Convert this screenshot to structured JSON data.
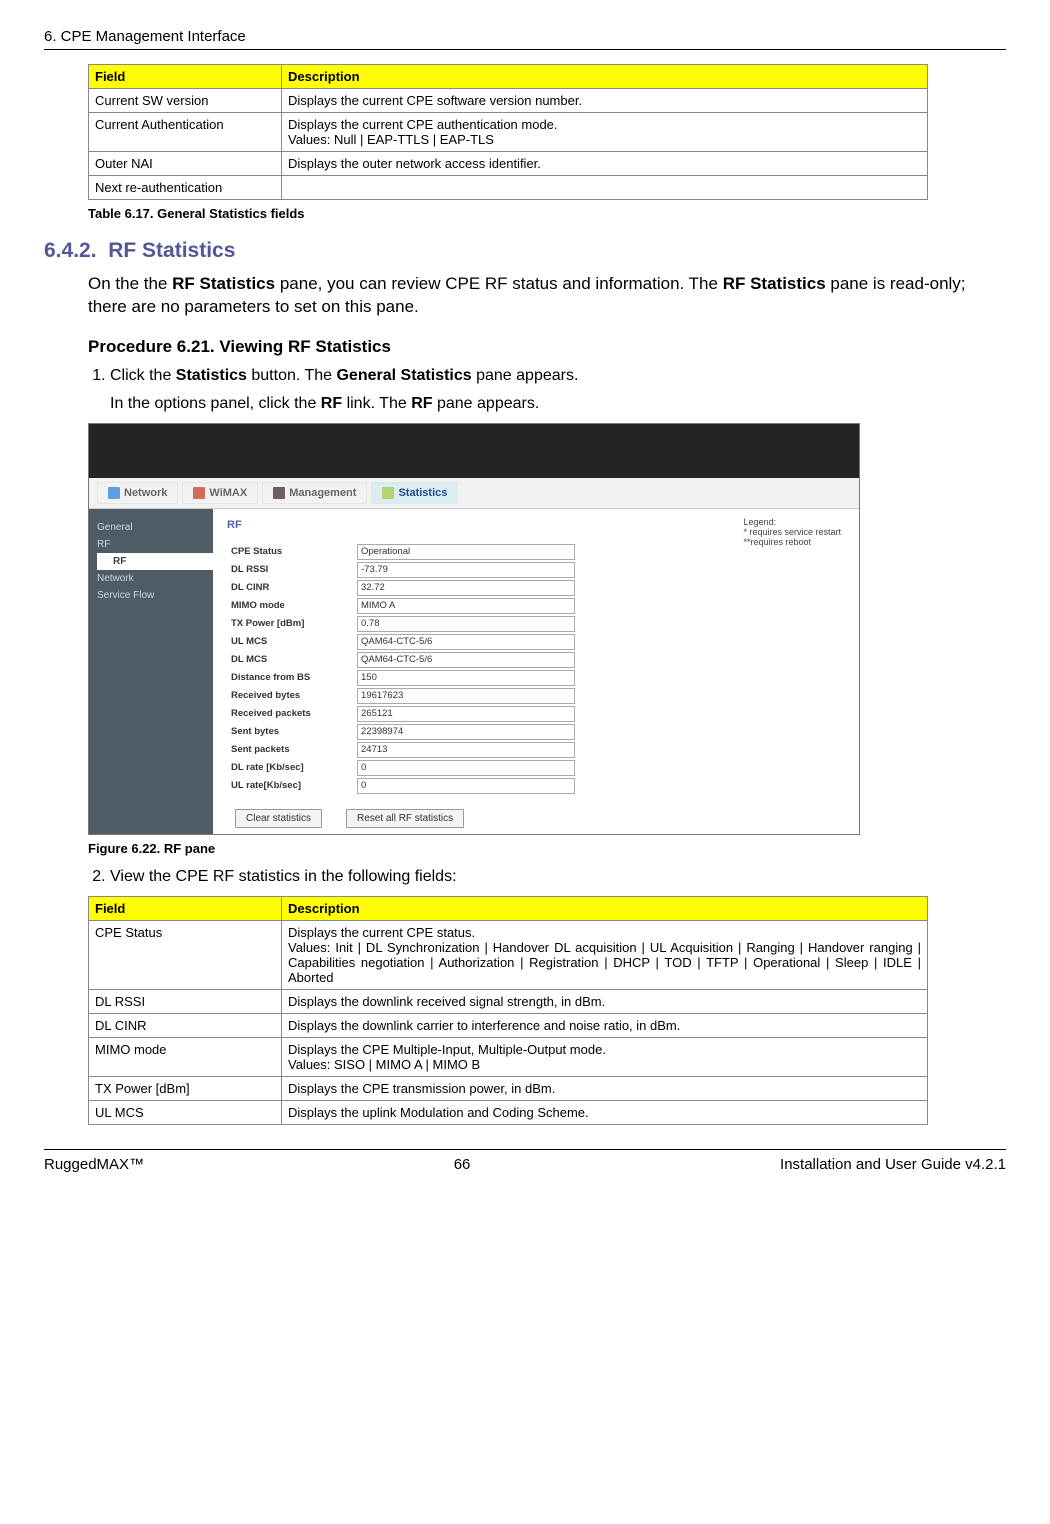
{
  "header": {
    "left": "6. CPE Management Interface"
  },
  "table1": {
    "headers": {
      "field": "Field",
      "desc": "Description"
    },
    "rows": [
      {
        "field": "Current SW version",
        "desc": "Displays the current CPE software version number."
      },
      {
        "field": "Current Authentication",
        "desc": "Displays the current CPE authentication mode.\nValues: Null | EAP-TTLS | EAP-TLS"
      },
      {
        "field": "Outer NAI",
        "desc": "Displays the outer network access identifier."
      },
      {
        "field": "Next re-authentication",
        "desc": ""
      }
    ],
    "caption": "Table 6.17. General Statistics fields"
  },
  "section": {
    "number": "6.4.2.",
    "title": "RF Statistics",
    "para_parts": [
      "On the the ",
      "RF Statistics",
      " pane, you can review CPE RF status and information. The ",
      "RF Statistics",
      " pane is read-only; there are no parameters to set on this pane."
    ],
    "proc_title": "Procedure 6.21. Viewing RF Statistics",
    "step1_parts": [
      "Click the ",
      "Statistics",
      " button. The ",
      "General Statistics",
      " pane appears."
    ],
    "step1_sub_parts": [
      "In the options panel, click the ",
      "RF",
      " link. The ",
      "RF",
      " pane appears."
    ],
    "figure_caption": "Figure 6.22. RF pane",
    "step2": "View the CPE RF statistics in the following fields:"
  },
  "screenshot": {
    "nav": [
      {
        "label": "Network",
        "icon": "blue"
      },
      {
        "label": "WiMAX",
        "icon": "red"
      },
      {
        "label": "Management",
        "icon": "dark"
      },
      {
        "label": "Statistics",
        "icon": "chart",
        "active": true
      }
    ],
    "sidebar": [
      {
        "label": "General"
      },
      {
        "label": "RF"
      },
      {
        "label": "RF",
        "selected": true
      },
      {
        "label": "Network"
      },
      {
        "label": "Service Flow"
      }
    ],
    "legend": {
      "title": "Legend:",
      "l1": "* requires service restart",
      "l2": "**requires reboot"
    },
    "panel_title": "RF",
    "fields": [
      {
        "label": "CPE Status",
        "value": "Operational"
      },
      {
        "label": "DL RSSI",
        "value": "-73.79"
      },
      {
        "label": "DL CINR",
        "value": "32.72"
      },
      {
        "label": "MIMO mode",
        "value": "MIMO A"
      },
      {
        "label": "TX Power [dBm]",
        "value": "0.78"
      },
      {
        "label": "UL MCS",
        "value": "QAM64-CTC-5/6"
      },
      {
        "label": "DL MCS",
        "value": "QAM64-CTC-5/6"
      },
      {
        "label": "Distance from BS",
        "value": "150"
      },
      {
        "label": "Received bytes",
        "value": "19617623"
      },
      {
        "label": "Received packets",
        "value": "265121"
      },
      {
        "label": "Sent bytes",
        "value": "22398974"
      },
      {
        "label": "Sent packets",
        "value": "24713"
      },
      {
        "label": "DL rate [Kb/sec]",
        "value": "0"
      },
      {
        "label": "UL rate[Kb/sec]",
        "value": "0"
      }
    ],
    "buttons": {
      "clear": "Clear statistics",
      "reset": "Reset all RF statistics"
    }
  },
  "table2": {
    "headers": {
      "field": "Field",
      "desc": "Description"
    },
    "rows": [
      {
        "field": "CPE Status",
        "desc": "Displays the current CPE status.\nValues: Init | DL Synchronization | Handover DL acquisition | UL Acquisition | Ranging | Handover ranging | Capabilities negotiation | Authorization | Registration | DHCP | TOD | TFTP | Operational | Sleep | IDLE | Aborted"
      },
      {
        "field": "DL RSSI",
        "desc": "Displays the downlink received signal strength, in dBm."
      },
      {
        "field": "DL CINR",
        "desc": "Displays the downlink carrier to interference and noise ratio, in dBm."
      },
      {
        "field": "MIMO mode",
        "desc": "Displays the CPE Multiple-Input, Multiple-Output mode.\nValues: SISO | MIMO A | MIMO B"
      },
      {
        "field": "TX Power [dBm]",
        "desc": "Displays the CPE transmission power, in dBm."
      },
      {
        "field": "UL MCS",
        "desc": "Displays the uplink Modulation and Coding Scheme."
      }
    ]
  },
  "footer": {
    "left": "RuggedMAX™",
    "center": "66",
    "right": "Installation and User Guide v4.2.1"
  }
}
